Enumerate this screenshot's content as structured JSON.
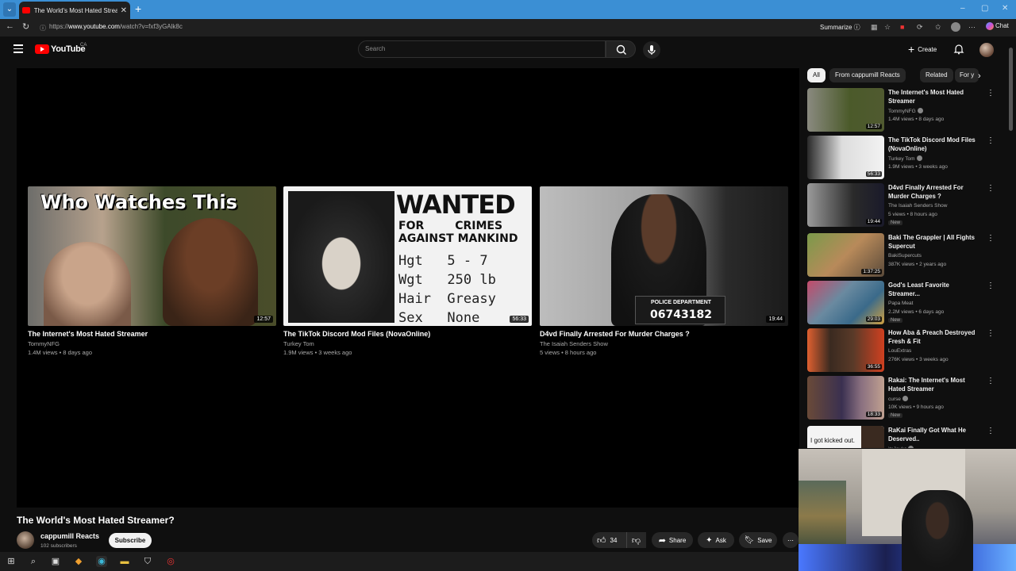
{
  "browser": {
    "tab_title": "The World's Most Hated Streamer?",
    "url_prefix": "https://",
    "url_domain": "www.youtube.com",
    "url_path": "/watch?v=fxf3yGAlk8c",
    "summarize_label": "Summarize",
    "chat_label": "Chat"
  },
  "youtube": {
    "logo_text": "YouTube",
    "country": "CA",
    "search_placeholder": "Search",
    "create_label": "Create"
  },
  "endscreen": [
    {
      "title": "The Internet's Most Hated Streamer",
      "channel": "TommyNFG",
      "meta": "1.4M views • 8 days ago",
      "duration": "12:57",
      "overlay": "Who Watches This"
    },
    {
      "title": "The TikTok Discord Mod Files (NovaOnline)",
      "channel": "Turkey Tom",
      "meta": "1.9M views • 3 weeks ago",
      "duration": "56:33",
      "overlay_wanted": "WANTED",
      "overlay_crimes_1": "FOR        CRIMES",
      "overlay_crimes_2": "AGAINST MANKIND",
      "stat_1": "Hgt   5 - 7",
      "stat_2": "Wgt   250 lb",
      "stat_3": "Hair  Greasy",
      "stat_4": "Sex   None"
    },
    {
      "title": "D4vd Finally Arrested For Murder Charges ?",
      "channel": "The Isaiah Senders Show",
      "meta": "5 views • 8 hours ago",
      "duration": "19:44",
      "overlay_pd": "POLICE DEPARTMENT",
      "overlay_num": "06743182"
    }
  ],
  "video": {
    "title": "The World's Most Hated Streamer?",
    "channel": "cappumill Reacts",
    "subscribers": "102 subscribers",
    "subscribe_label": "Subscribe",
    "likes": "34",
    "share_label": "Share",
    "ask_label": "Ask",
    "save_label": "Save"
  },
  "chips": [
    "All",
    "From cappumill Reacts",
    "Related",
    "For y"
  ],
  "sidebar": [
    {
      "title": "The Internet's Most Hated Streamer",
      "channel": "TommyNFG",
      "meta": "1.4M views • 8 days ago",
      "duration": "12:57",
      "verified": true,
      "new": ""
    },
    {
      "title": "The TikTok Discord Mod Files (NovaOnline)",
      "channel": "Turkey Tom",
      "meta": "1.9M views • 3 weeks ago",
      "duration": "56:33",
      "verified": true,
      "new": ""
    },
    {
      "title": "D4vd Finally Arrested For Murder Charges ?",
      "channel": "The Isaiah Senders Show",
      "meta": "5 views • 8 hours ago",
      "duration": "19:44",
      "verified": false,
      "new": "New"
    },
    {
      "title": "Baki The Grappler | All Fights Supercut",
      "channel": "BakiSupercuts",
      "meta": "387K views • 2 years ago",
      "duration": "1:37:25",
      "verified": false,
      "new": ""
    },
    {
      "title": "God's Least Favorite Streamer...",
      "channel": "Papa Meat",
      "meta": "2.2M views • 6 days ago",
      "duration": "29:03",
      "verified": false,
      "new": "New"
    },
    {
      "title": "How Aba & Preach Destroyed Fresh & Fit",
      "channel": "LouExtras",
      "meta": "276K views • 3 weeks ago",
      "duration": "36:55",
      "verified": false,
      "new": ""
    },
    {
      "title": "Rakai: The Internet's Most Hated Streamer",
      "channel": "curse",
      "meta": "10K views • 9 hours ago",
      "duration": "18:33",
      "verified": true,
      "new": "New"
    },
    {
      "title": "RaKai Finally Got What He Deserved..",
      "channel": "itsJayko",
      "meta": "",
      "duration": "",
      "verified": true,
      "new": "",
      "thumb_text": "I got kicked out."
    }
  ],
  "colors": {
    "brand_red": "#ff0000",
    "background": "#0f0f0f",
    "browser_blue": "#3b8fd4"
  }
}
